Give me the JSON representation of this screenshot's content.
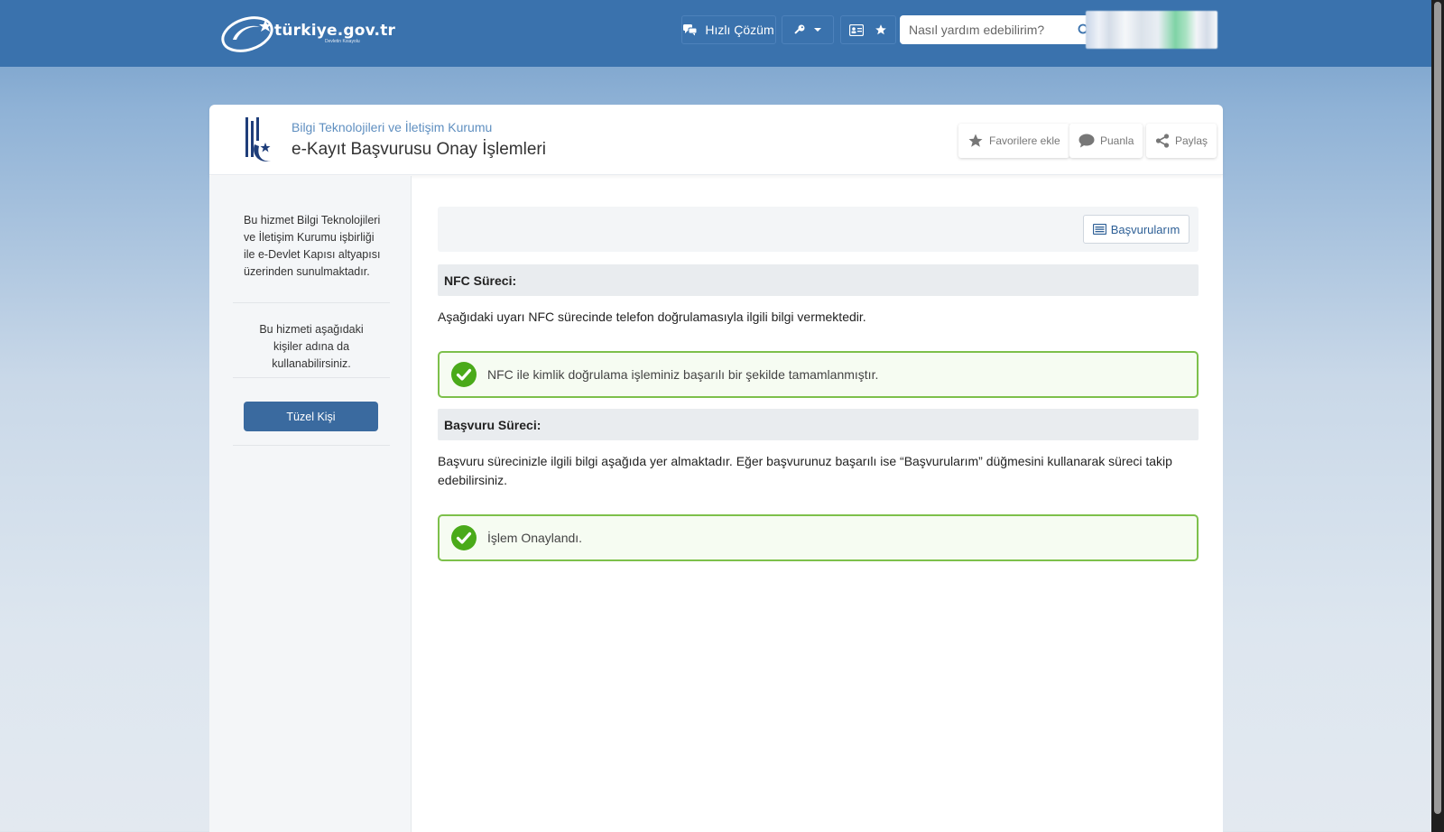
{
  "header": {
    "logo_text": "türkiye.gov.tr",
    "logo_sub": "Devletin Kısayolu",
    "quick_solution_label": "Hızlı Çözüm",
    "search_placeholder": "Nasıl yardım edebilirim?"
  },
  "service": {
    "agency_name": "Bilgi Teknolojileri ve İletişim Kurumu",
    "title": "e-Kayıt Başvurusu Onay İşlemleri",
    "actions": {
      "favorite_label": "Favorilere ekle",
      "rate_label": "Puanla",
      "share_label": "Paylaş"
    }
  },
  "sidebar": {
    "info_text": "Bu hizmet Bilgi Teknolojileri ve İletişim Kurumu işbirliği ile e-Devlet Kapısı altyapısı üzerinden sunulmaktadır.",
    "on_behalf_text": "Bu hizmeti aşağıdaki kişiler adına da kullanabilirsiniz.",
    "legal_entity_button": "Tüzel Kişi"
  },
  "main": {
    "my_applications_label": "Başvurularım",
    "nfc_section": {
      "heading": "NFC Süreci:",
      "description": "Aşağıdaki uyarı NFC sürecinde telefon doğrulamasıyla ilgili bilgi vermektedir.",
      "alert": "NFC ile kimlik doğrulama işleminiz başarılı bir şekilde tamamlanmıştır."
    },
    "application_section": {
      "heading": "Başvuru Süreci:",
      "description": "Başvuru sürecinizle ilgili bilgi aşağıda yer almaktadır. Eğer başvurunuz başarılı ise “Başvurularım” düğmesini kullanarak süreci takip edebilirsiniz.",
      "alert": "İşlem Onaylandı."
    }
  },
  "colors": {
    "topbar": "#3a72ad",
    "success_border": "#7dc04b",
    "success_icon": "#4aaa1a",
    "primary_button": "#3a6a9f"
  },
  "icons": {
    "quick_solution": "chat-bubbles-icon",
    "key": "key-icon",
    "id_card": "id-card-icon",
    "star": "star-icon",
    "search": "search-icon",
    "share": "share-icon",
    "success": "check-circle-icon"
  }
}
